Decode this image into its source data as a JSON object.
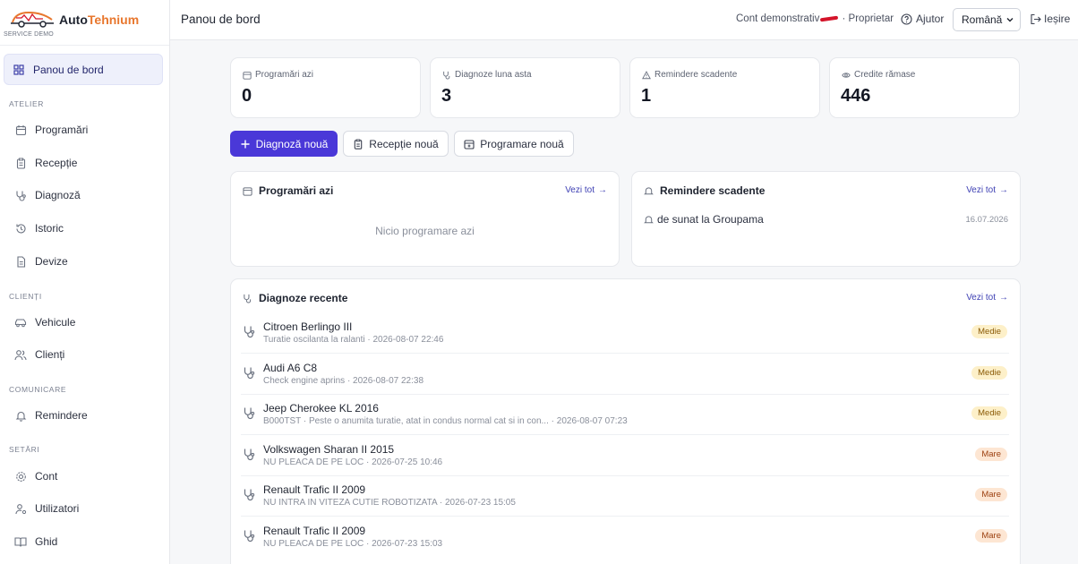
{
  "brand": {
    "name_a": "Auto",
    "name_b": "Tehnium",
    "subtitle": "SERVICE DEMO"
  },
  "sidebar": {
    "active": {
      "label": "Panou de bord",
      "icon": "grid-icon"
    },
    "sections": [
      {
        "title": "ATELIER",
        "items": [
          {
            "label": "Programări",
            "icon": "calendar-icon"
          },
          {
            "label": "Recepție",
            "icon": "clipboard-icon"
          },
          {
            "label": "Diagnoză",
            "icon": "stethoscope-icon"
          },
          {
            "label": "Istoric",
            "icon": "history-icon"
          },
          {
            "label": "Devize",
            "icon": "document-icon"
          }
        ]
      },
      {
        "title": "CLIENȚI",
        "items": [
          {
            "label": "Vehicule",
            "icon": "car-icon"
          },
          {
            "label": "Clienți",
            "icon": "users-icon"
          }
        ]
      },
      {
        "title": "COMUNICARE",
        "items": [
          {
            "label": "Remindere",
            "icon": "bell-icon"
          }
        ]
      },
      {
        "title": "SETĂRI",
        "items": [
          {
            "label": "Cont",
            "icon": "gear-icon"
          },
          {
            "label": "Utilizatori",
            "icon": "user-key-icon"
          },
          {
            "label": "Ghid",
            "icon": "book-icon"
          }
        ]
      }
    ]
  },
  "header": {
    "title": "Panou de bord",
    "account_prefix": "Cont demonstrativ",
    "account_role": "· Proprietar",
    "help_label": "Ajutor",
    "language": "Română",
    "logout_label": "Ieșire"
  },
  "stats": [
    {
      "label": "Programări azi",
      "value": "0",
      "icon": "calendar-icon"
    },
    {
      "label": "Diagnoze luna asta",
      "value": "3",
      "icon": "stethoscope-icon"
    },
    {
      "label": "Remindere scadente",
      "value": "1",
      "icon": "warning-icon"
    },
    {
      "label": "Credite rămase",
      "value": "446",
      "icon": "eye-icon"
    }
  ],
  "actions": {
    "new_diagnosis": "Diagnoză nouă",
    "new_reception": "Recepție nouă",
    "new_appointment": "Programare nouă"
  },
  "appointments_panel": {
    "title": "Programări azi",
    "see_all": "Vezi tot",
    "empty": "Nicio programare azi"
  },
  "reminders_panel": {
    "title": "Remindere scadente",
    "see_all": "Vezi tot",
    "items": [
      {
        "text": "de sunat la Groupama",
        "date": "16.07.2026"
      }
    ]
  },
  "diagnoses_panel": {
    "title": "Diagnoze recente",
    "see_all": "Vezi tot",
    "rows": [
      {
        "vehicle": "Citroen Berlingo III",
        "meta": "Turatie oscilanta la ralanti · 2026-08-07 22:46",
        "severity": "Medie"
      },
      {
        "vehicle": "Audi A6 C8",
        "meta": "Check engine aprins · 2026-08-07 22:38",
        "severity": "Medie"
      },
      {
        "vehicle": "Jeep Cherokee KL 2016",
        "meta": "B000TST · Peste o anumita turatie, atat in condus normal cat si in con... · 2026-08-07 07:23",
        "severity": "Medie"
      },
      {
        "vehicle": "Volkswagen Sharan II 2015",
        "meta": "NU PLEACA DE PE LOC · 2026-07-25 10:46",
        "severity": "Mare"
      },
      {
        "vehicle": "Renault Trafic II 2009",
        "meta": "NU INTRA IN VITEZA CUTIE ROBOTIZATA · 2026-07-23 15:05",
        "severity": "Mare"
      },
      {
        "vehicle": "Renault Trafic II 2009",
        "meta": "NU PLEACA DE PE LOC · 2026-07-23 15:03",
        "severity": "Mare"
      }
    ]
  },
  "colors": {
    "primary": "#4a38d8",
    "brand_accent": "#e8772e",
    "badge_medie_bg": "#fdf0c9",
    "badge_mare_bg": "#fde6d3"
  }
}
